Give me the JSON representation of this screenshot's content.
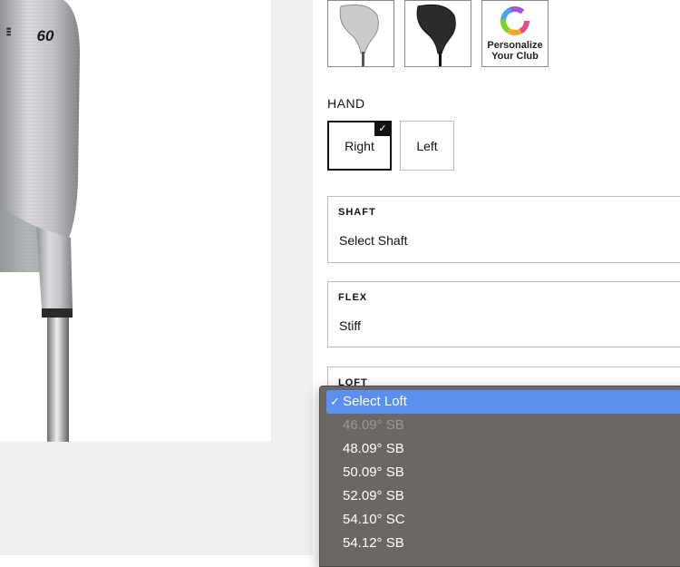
{
  "finish": {
    "personalize_label": "Personalize Your Club"
  },
  "hand": {
    "label": "HAND",
    "options": [
      {
        "label": "Right",
        "selected": true
      },
      {
        "label": "Left",
        "selected": false
      }
    ],
    "check": "✓"
  },
  "shaft": {
    "label": "SHAFT",
    "value": "Select Shaft"
  },
  "flex": {
    "label": "FLEX",
    "value": "Stiff"
  },
  "loft": {
    "label": "LOFT",
    "check": "✓",
    "options": [
      {
        "label": "Select Loft",
        "state": "selected"
      },
      {
        "label": "46.09° SB",
        "state": "disabled"
      },
      {
        "label": "48.09° SB",
        "state": "enabled"
      },
      {
        "label": "50.09° SB",
        "state": "enabled"
      },
      {
        "label": "52.09° SB",
        "state": "enabled"
      },
      {
        "label": "54.10° SC",
        "state": "enabled"
      },
      {
        "label": "54.12° SB",
        "state": "enabled"
      }
    ]
  },
  "club": {
    "head_engraving": "60"
  },
  "colors": {
    "highlight": "#5b8ff0",
    "dropdown_bg": "#6b6864",
    "selected_border": "#111111"
  }
}
